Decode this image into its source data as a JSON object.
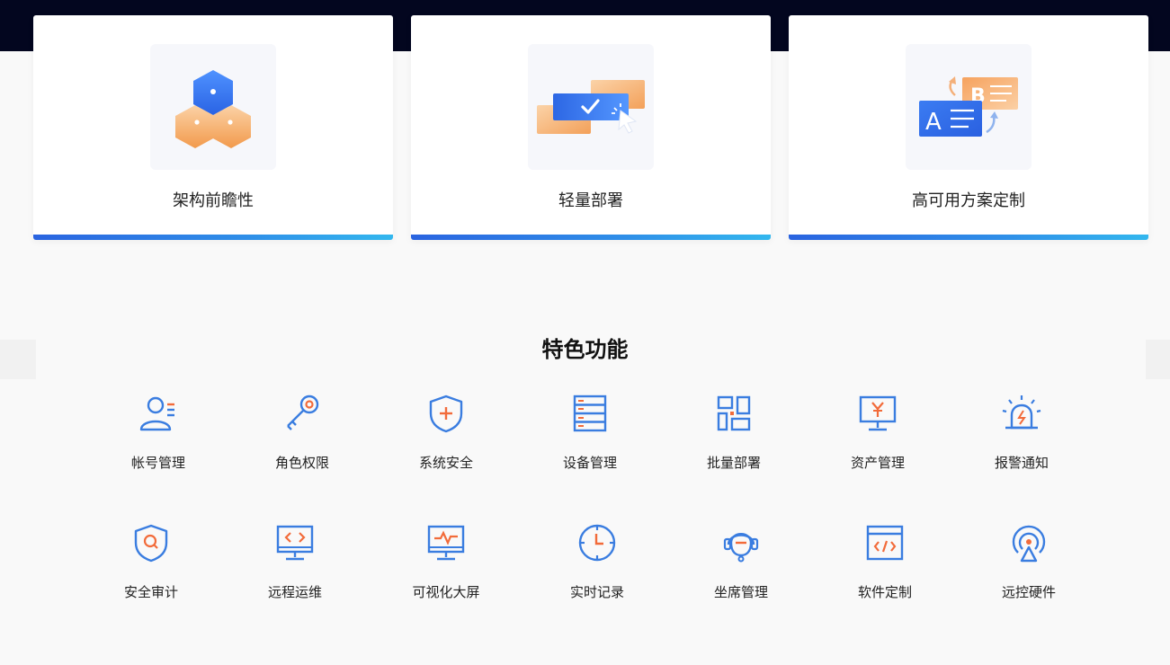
{
  "cards": [
    {
      "title": "架构前瞻性",
      "icon": "hexagon-cluster-icon"
    },
    {
      "title": "轻量部署",
      "icon": "deploy-check-icon"
    },
    {
      "title": "高可用方案定制",
      "icon": "a-b-switch-icon"
    }
  ],
  "section": {
    "title": "特色功能"
  },
  "features_row1": [
    {
      "label": "帐号管理",
      "icon": "account-icon"
    },
    {
      "label": "角色权限",
      "icon": "key-icon"
    },
    {
      "label": "系统安全",
      "icon": "shield-plus-icon"
    },
    {
      "label": "设备管理",
      "icon": "server-rack-icon"
    },
    {
      "label": "批量部署",
      "icon": "grid-blocks-icon"
    },
    {
      "label": "资产管理",
      "icon": "monitor-yen-icon"
    },
    {
      "label": "报警通知",
      "icon": "alarm-light-icon"
    }
  ],
  "features_row2": [
    {
      "label": "安全审计",
      "icon": "shield-search-icon"
    },
    {
      "label": "远程运维",
      "icon": "monitor-code-icon"
    },
    {
      "label": "可视化大屏",
      "icon": "monitor-pulse-icon"
    },
    {
      "label": "实时记录",
      "icon": "clock-icon"
    },
    {
      "label": "坐席管理",
      "icon": "headset-icon"
    },
    {
      "label": "软件定制",
      "icon": "browser-code-icon"
    },
    {
      "label": "远控硬件",
      "icon": "remote-signal-icon"
    }
  ],
  "colors": {
    "accent_blue": "#3a7de0",
    "accent_orange": "#f26b3a",
    "card_bar_start": "#2a64e0",
    "card_bar_end": "#33b7ee",
    "top_band": "#03061f"
  }
}
